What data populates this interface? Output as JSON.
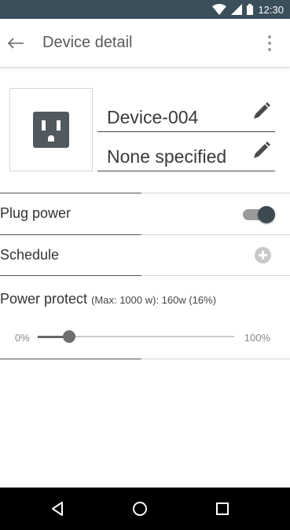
{
  "status_bar": {
    "time": "12:30"
  },
  "app_bar": {
    "title": "Device detail"
  },
  "device": {
    "name": "Device-004",
    "description": "None specified"
  },
  "rows": {
    "plug_power": {
      "label": "Plug power",
      "enabled": true
    },
    "schedule": {
      "label": "Schedule"
    }
  },
  "power_protect": {
    "title": "Power protect",
    "meta": "(Max: 1000 w):  160w (16%)",
    "slider_min_label": "0%",
    "slider_max_label": "100%",
    "value_fraction": 0.16
  },
  "colors": {
    "status_bar": "#3a4f5a",
    "toggle_thumb": "#3d4a52",
    "outlet": "#505a5f"
  }
}
